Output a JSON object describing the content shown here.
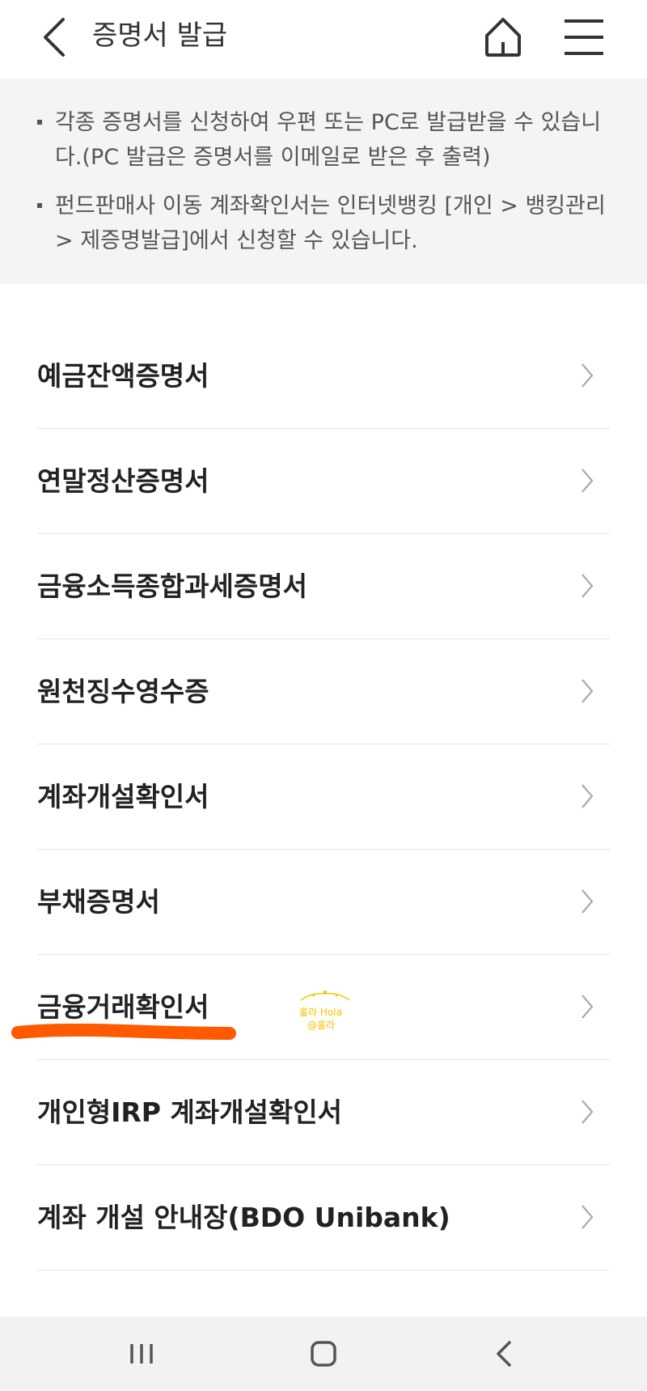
{
  "header": {
    "title": "증명서 발급",
    "icons": {
      "back": "chevron-left-icon",
      "home": "home-icon",
      "menu": "hamburger-menu-icon"
    }
  },
  "notice": {
    "items": [
      {
        "text": "각종 증명서를 신청하여 우편 또는 PC로 발급받을 수 있습니다.(PC 발급은 증명서를 이메일로 받은 후 출력)"
      },
      {
        "text": "펀드판매사 이동 계좌확인서는 인터넷뱅킹 [개인 > 뱅킹관리 > 제증명발급]에서 신청할 수 있습니다."
      }
    ]
  },
  "certificates": {
    "items": [
      {
        "label": "예금잔액증명서"
      },
      {
        "label": "연말정산증명서"
      },
      {
        "label": "금융소득종합과세증명서"
      },
      {
        "label": "원천징수영수증"
      },
      {
        "label": "계좌개설확인서"
      },
      {
        "label": "부채증명서"
      },
      {
        "label": "금융거래확인서"
      },
      {
        "label": "개인형IRP 계좌개설확인서"
      },
      {
        "label": "계좌 개설 안내장(BDO Unibank)"
      }
    ]
  },
  "watermark": {
    "line1": "홀라 Hola",
    "line2": "@홀라"
  },
  "colors": {
    "highlight_underline": "#ff5a00",
    "notice_bg": "#f4f4f4",
    "watermark": "#f2c400"
  }
}
